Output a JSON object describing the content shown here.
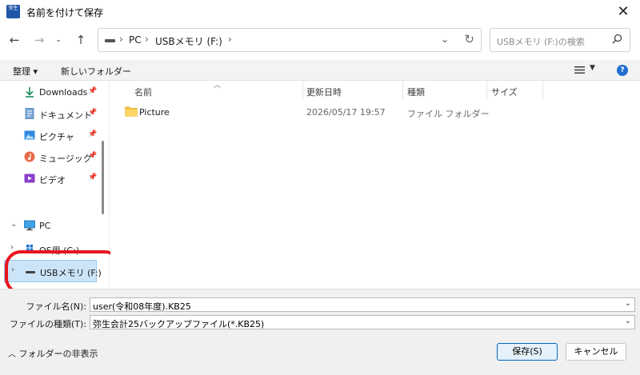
{
  "window": {
    "title": "名前を付けて保存",
    "icon_text": "弥生"
  },
  "address": {
    "segments": [
      "PC",
      "USBメモリ (F:)"
    ]
  },
  "search": {
    "placeholder": "USBメモリ (F:)の検索"
  },
  "toolbar": {
    "organize": "整理 ▾",
    "new_folder": "新しいフォルダー"
  },
  "sidebar": {
    "quick_access": [
      {
        "label": "Downloads",
        "icon": "download-icon",
        "pinned": true
      },
      {
        "label": "ドキュメント",
        "icon": "document-icon",
        "pinned": true
      },
      {
        "label": "ピクチャ",
        "icon": "pictures-icon",
        "pinned": true
      },
      {
        "label": "ミュージック",
        "icon": "music-icon",
        "pinned": true
      },
      {
        "label": "ビデオ",
        "icon": "video-icon",
        "pinned": true
      }
    ],
    "pc": {
      "label": "PC"
    },
    "os_drive": {
      "label": "OS用 (C:)"
    },
    "usb_drive": {
      "label": "USBメモリ (F:)",
      "selected": true
    }
  },
  "columns": [
    "名前",
    "更新日時",
    "種類",
    "サイズ"
  ],
  "files": [
    {
      "name": "Picture",
      "modified": "2026/05/17 19:57",
      "type": "ファイル フォルダー",
      "size": ""
    }
  ],
  "form": {
    "filename_label": "ファイル名(N):",
    "filename_value": "user(令和08年度).KB25",
    "filetype_label": "ファイルの種類(T):",
    "filetype_value": "弥生会計25バックアップファイル(*.KB25)"
  },
  "footer": {
    "hide_folders": "フォルダーの非表示",
    "save_button": "保存(S)",
    "cancel_button": "キャンセル"
  },
  "colors": {
    "accent": "#0067c0",
    "annotation": "#e8141d",
    "folder": "#f5c342"
  }
}
